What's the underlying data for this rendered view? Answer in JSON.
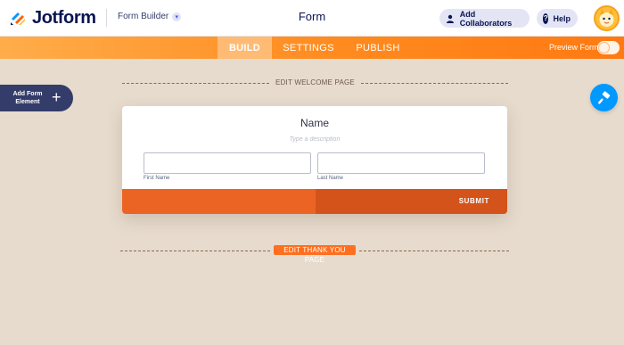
{
  "header": {
    "logo_text": "Jotform",
    "builder_label": "Form Builder",
    "form_title": "Form",
    "collaborators_label": "Add Collaborators",
    "help_label": "Help"
  },
  "nav": {
    "tabs": [
      {
        "label": "BUILD",
        "active": true
      },
      {
        "label": "SETTINGS",
        "active": false
      },
      {
        "label": "PUBLISH",
        "active": false
      }
    ],
    "preview_label": "Preview Form",
    "preview_enabled": false
  },
  "sidebar": {
    "add_element_label_line1": "Add Form",
    "add_element_label_line2": "Element"
  },
  "canvas": {
    "welcome_label": "EDIT WELCOME PAGE",
    "thanks_label": "EDIT THANK YOU PAGE"
  },
  "form": {
    "field_label": "Name",
    "description_placeholder": "Type a description",
    "first_sublabel": "First Name",
    "last_sublabel": "Last Name",
    "first_value": "",
    "last_value": "",
    "submit_label": "SUBMIT"
  },
  "colors": {
    "brand_navy": "#0a1551",
    "accent_orange": "#ff7a12",
    "submit_orange": "#ec6423",
    "canvas_bg": "#e7dbcd",
    "paint_blue": "#0099ff"
  },
  "icons": {
    "logo": "jotform-logo-icon",
    "dropdown": "chevron-down-icon",
    "collaborators": "user-icon",
    "help": "question-icon",
    "add": "plus-icon",
    "paint": "paint-roller-icon"
  }
}
